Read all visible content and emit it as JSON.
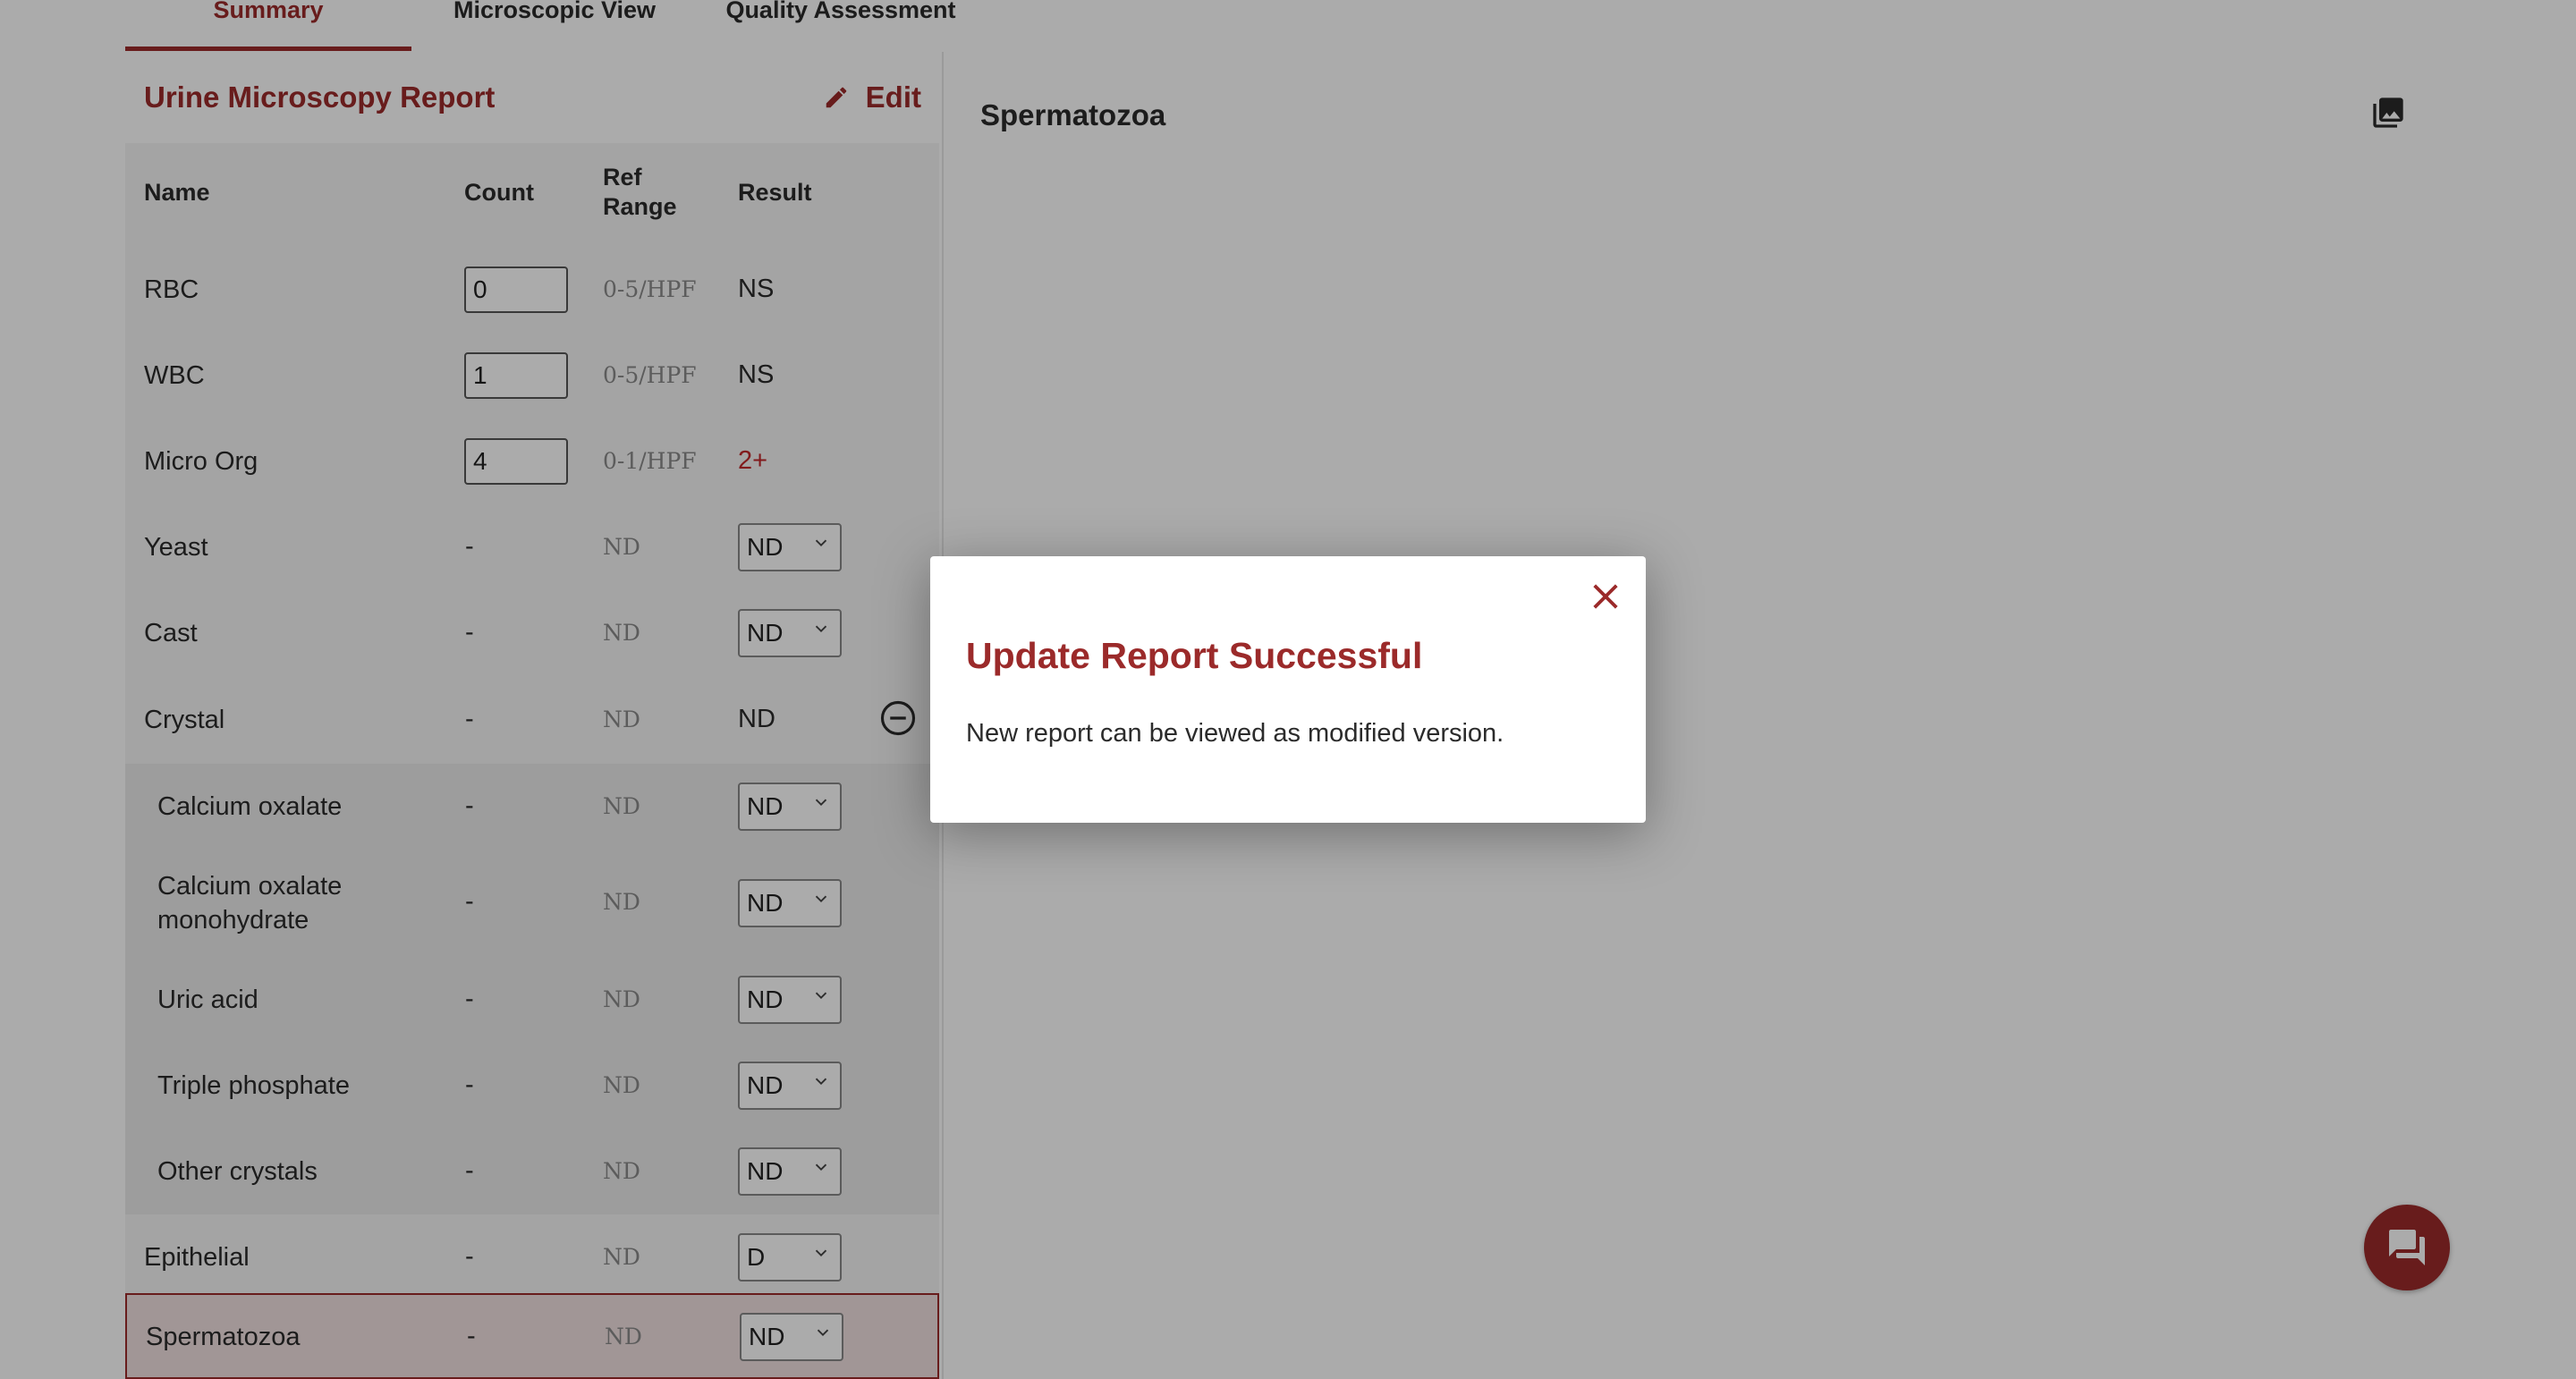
{
  "tabs": [
    {
      "label": "Summary",
      "active": true
    },
    {
      "label": "Microscopic View",
      "active": false
    },
    {
      "label": "Quality Assessment",
      "active": false
    }
  ],
  "report": {
    "title": "Urine Microscopy Report",
    "edit_label": "Edit",
    "columns": {
      "name": "Name",
      "count": "Count",
      "ref_range": "Ref Range",
      "result": "Result"
    },
    "rows": [
      {
        "name": "RBC",
        "count": "0",
        "ref": "0-5/HPF",
        "result": "NS"
      },
      {
        "name": "WBC",
        "count": "1",
        "ref": "0-5/HPF",
        "result": "NS"
      },
      {
        "name": "Micro Org",
        "count": "4",
        "ref": "0-1/HPF",
        "result": "2+"
      },
      {
        "name": "Yeast",
        "count": "-",
        "ref": "ND",
        "result": "ND"
      },
      {
        "name": "Cast",
        "count": "-",
        "ref": "ND",
        "result": "ND"
      },
      {
        "name": "Crystal",
        "count": "-",
        "ref": "ND",
        "result": "ND"
      },
      {
        "name": "Calcium oxalate",
        "count": "-",
        "ref": "ND",
        "result": "ND"
      },
      {
        "name": "Calcium oxalate monohydrate",
        "count": "-",
        "ref": "ND",
        "result": "ND"
      },
      {
        "name": "Uric acid",
        "count": "-",
        "ref": "ND",
        "result": "ND"
      },
      {
        "name": "Triple phosphate",
        "count": "-",
        "ref": "ND",
        "result": "ND"
      },
      {
        "name": "Other crystals",
        "count": "-",
        "ref": "ND",
        "result": "ND"
      },
      {
        "name": "Epithelial",
        "count": "-",
        "ref": "ND",
        "result": "D"
      },
      {
        "name": "Spermatozoa",
        "count": "-",
        "ref": "ND",
        "result": "ND"
      }
    ]
  },
  "viewer": {
    "title": "Spermatozoa",
    "icon": "image-gallery-icon"
  },
  "modal": {
    "title": "Update Report Successful",
    "message": "New report can be viewed as modified version."
  },
  "colors": {
    "accent": "#9b2a2a",
    "abnormal": "#c0282a"
  }
}
